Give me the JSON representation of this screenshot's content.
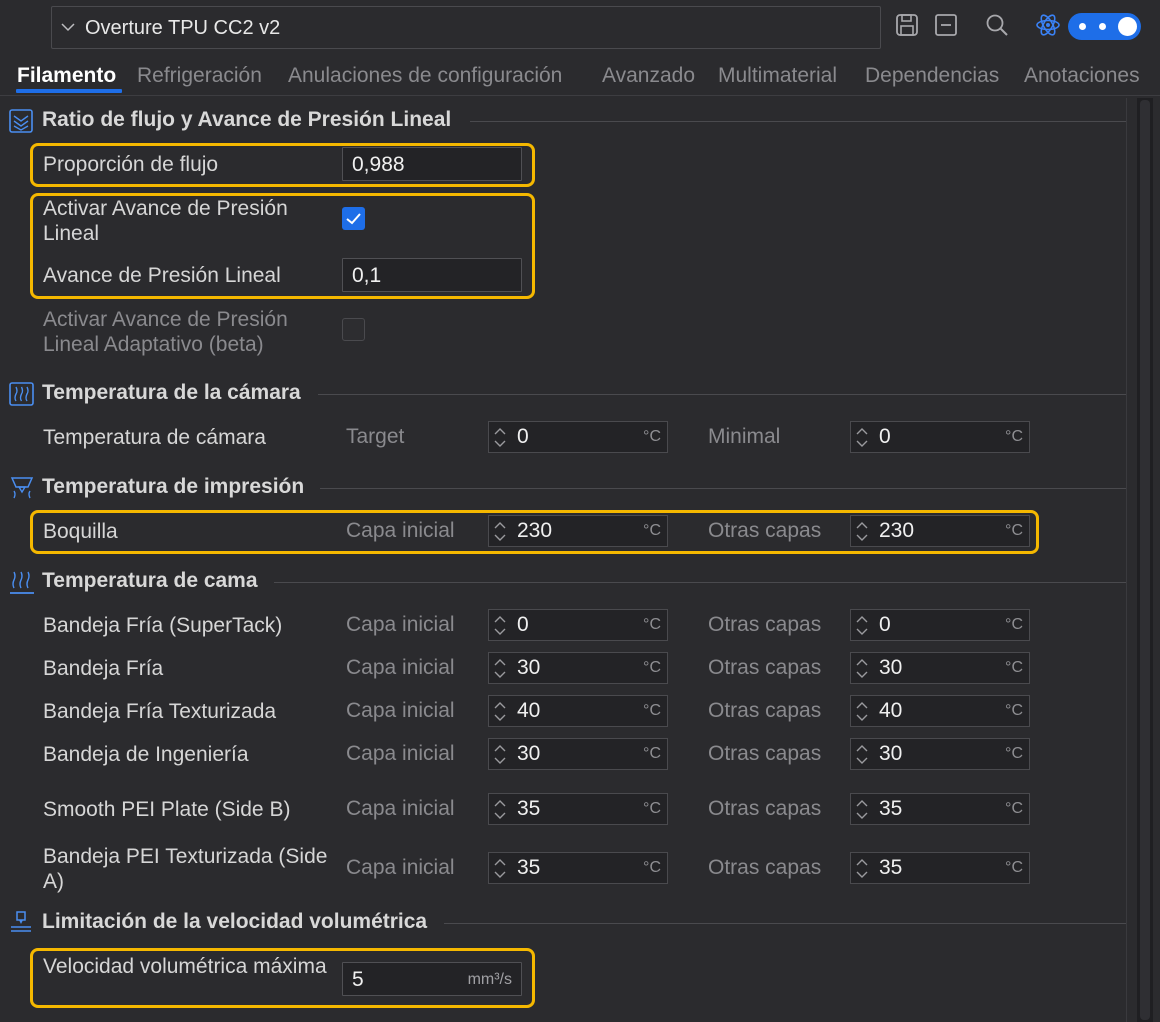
{
  "header": {
    "preset_name": "Overture TPU CC2 v2",
    "icons": [
      "chevron-down-icon",
      "save-icon",
      "collapse-icon",
      "search-icon",
      "atom-icon",
      "toggle-switch"
    ]
  },
  "tabs": [
    {
      "label": "Filamento",
      "active": true
    },
    {
      "label": "Refrigeración"
    },
    {
      "label": "Anulaciones de configuración"
    },
    {
      "label": "Avanzado"
    },
    {
      "label": "Multimaterial"
    },
    {
      "label": "Dependencias"
    },
    {
      "label": "Anotaciones"
    }
  ],
  "sections": {
    "flow": {
      "title": "Ratio de flujo y Avance de Presión Lineal",
      "flow_ratio_label": "Proporción de flujo",
      "flow_ratio_value": "0,988",
      "pa_enable_label": "Activar Avance de Presión Lineal",
      "pa_enable_checked": true,
      "pa_label": "Avance de Presión Lineal",
      "pa_value": "0,1",
      "adaptive_label": "Activar Avance de Presión Lineal Adaptativo (beta)",
      "adaptive_checked": false
    },
    "chamber": {
      "title": "Temperatura de la cámara",
      "label": "Temperatura de cámara",
      "target_label": "Target",
      "target_value": "0",
      "minimal_label": "Minimal",
      "minimal_value": "0",
      "unit": "°C"
    },
    "print_temp": {
      "title": "Temperatura de impresión",
      "nozzle_label": "Boquilla",
      "initial_label": "Capa inicial",
      "initial_value": "230",
      "other_label": "Otras capas",
      "other_value": "230",
      "unit": "°C"
    },
    "bed": {
      "title": "Temperatura de cama",
      "initial_label": "Capa inicial",
      "other_label": "Otras capas",
      "unit": "°C",
      "rows": [
        {
          "label": "Bandeja Fría (SuperTack)",
          "initial": "0",
          "other": "0"
        },
        {
          "label": "Bandeja Fría",
          "initial": "30",
          "other": "30"
        },
        {
          "label": "Bandeja Fría Texturizada",
          "initial": "40",
          "other": "40"
        },
        {
          "label": "Bandeja de Ingeniería",
          "initial": "30",
          "other": "30"
        },
        {
          "label": "Smooth PEI Plate (Side B)",
          "initial": "35",
          "other": "35"
        },
        {
          "label": "Bandeja PEI Texturizada (Side A)",
          "initial": "35",
          "other": "35"
        }
      ]
    },
    "volumetric": {
      "title": "Limitación de la velocidad volumétrica",
      "label": "Velocidad volumétrica máxima",
      "value": "5",
      "unit": "mm³/s"
    }
  },
  "colors": {
    "accent": "#1e6ee8",
    "highlight": "#f5b800",
    "background": "#2b2b2e"
  }
}
